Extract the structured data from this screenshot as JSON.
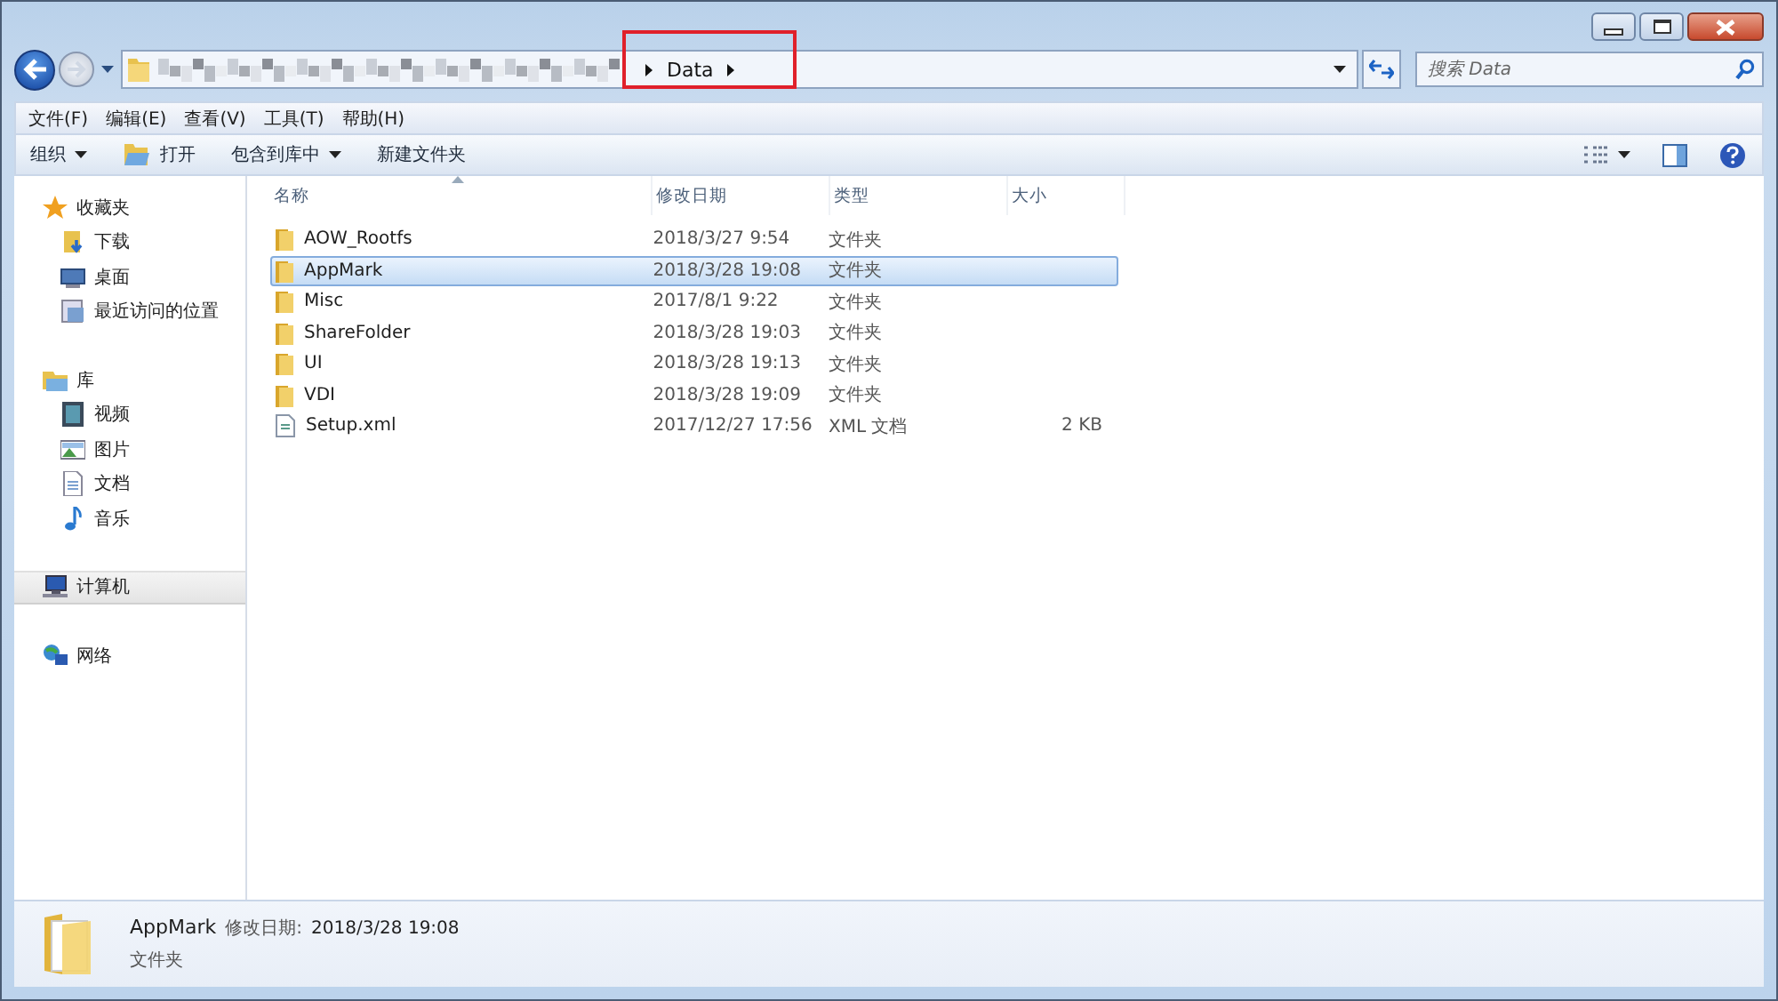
{
  "address_bar": {
    "segments": [
      "Data"
    ]
  },
  "search": {
    "placeholder": "搜索 Data"
  },
  "menu_bar": [
    "文件(F)",
    "编辑(E)",
    "查看(V)",
    "工具(T)",
    "帮助(H)"
  ],
  "toolbar": [
    {
      "label": "组织",
      "kind": "dropdown"
    },
    {
      "label": "打开",
      "kind": "icon"
    },
    {
      "label": "包含到库中",
      "kind": "dropdown"
    },
    {
      "label": "新建文件夹",
      "kind": "plain"
    }
  ],
  "sidebar": {
    "groups": [
      {
        "label": "收藏夹",
        "selected": false,
        "children": [
          {
            "label": "下载",
            "selected": false
          },
          {
            "label": "桌面",
            "selected": false
          },
          {
            "label": "最近访问的位置",
            "selected": false
          }
        ]
      },
      {
        "label": "库",
        "selected": false,
        "children": [
          {
            "label": "视频",
            "selected": false
          },
          {
            "label": "图片",
            "selected": false
          },
          {
            "label": "文档",
            "selected": false
          },
          {
            "label": "音乐",
            "selected": false
          }
        ]
      },
      {
        "label": "计算机",
        "selected": true
      },
      {
        "label": "网络",
        "selected": false
      }
    ]
  },
  "table": {
    "columns": [
      "名称",
      "修改日期",
      "类型",
      "大小"
    ],
    "rows": [
      {
        "kind": "folder",
        "name": "AOW_Rootfs",
        "date": "2018/3/27 9:54",
        "type": "文件夹",
        "selected": false
      },
      {
        "kind": "folder",
        "name": "AppMark",
        "date": "2018/3/28 19:08",
        "type": "文件夹",
        "selected": true
      },
      {
        "kind": "folder",
        "name": "Misc",
        "date": "2017/8/1 9:22",
        "type": "文件夹",
        "selected": false
      },
      {
        "kind": "folder",
        "name": "ShareFolder",
        "date": "2018/3/28 19:03",
        "type": "文件夹",
        "selected": false
      },
      {
        "kind": "folder",
        "name": "UI",
        "date": "2018/3/28 19:13",
        "type": "文件夹",
        "selected": false
      },
      {
        "kind": "folder",
        "name": "VDI",
        "date": "2018/3/28 19:09",
        "type": "文件夹",
        "selected": false
      },
      {
        "kind": "file",
        "name": "Setup.xml",
        "date": "2017/12/27 17:56",
        "type": "XML 文档",
        "size": "2 KB",
        "selected": false
      }
    ]
  },
  "details_pane": {
    "name": "AppMark",
    "date_label": "修改日期:",
    "date": "2018/3/28 19:08",
    "type": "文件夹"
  }
}
